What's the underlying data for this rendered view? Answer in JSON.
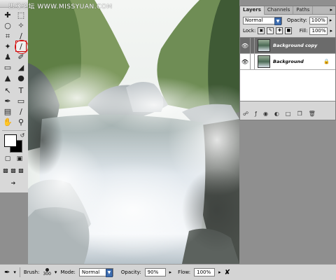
{
  "watermark": "思缘论坛 WWW.MISSYUAN.COM",
  "toolbox": {
    "tools": [
      {
        "name": "move-tool-icon",
        "glyph": "✚"
      },
      {
        "name": "marquee-tool-icon",
        "glyph": "⬚"
      },
      {
        "name": "lasso-tool-icon",
        "glyph": "○"
      },
      {
        "name": "magic-wand-tool-icon",
        "glyph": "✧"
      },
      {
        "name": "crop-tool-icon",
        "glyph": "⌗"
      },
      {
        "name": "slice-tool-icon",
        "glyph": "∕"
      },
      {
        "name": "healing-brush-tool-icon",
        "glyph": "✦"
      },
      {
        "name": "brush-tool-icon",
        "glyph": "∕"
      },
      {
        "name": "clone-stamp-tool-icon",
        "glyph": "♟"
      },
      {
        "name": "history-brush-tool-icon",
        "glyph": "✐"
      },
      {
        "name": "eraser-tool-icon",
        "glyph": "▭"
      },
      {
        "name": "paint-bucket-tool-icon",
        "glyph": "◢"
      },
      {
        "name": "blur-tool-icon",
        "glyph": "▲"
      },
      {
        "name": "dodge-tool-icon",
        "glyph": "●"
      },
      {
        "name": "path-selection-tool-icon",
        "glyph": "↖"
      },
      {
        "name": "type-tool-icon",
        "glyph": "T"
      },
      {
        "name": "pen-tool-icon",
        "glyph": "✒"
      },
      {
        "name": "shape-tool-icon",
        "glyph": "▭"
      },
      {
        "name": "notes-tool-icon",
        "glyph": "▤"
      },
      {
        "name": "eyedropper-tool-icon",
        "glyph": "∕"
      },
      {
        "name": "hand-tool-icon",
        "glyph": "✋"
      },
      {
        "name": "zoom-tool-icon",
        "glyph": "⚲"
      }
    ]
  },
  "layers_panel": {
    "tabs": [
      "Layers",
      "Channels",
      "Paths"
    ],
    "blend_mode": "Normal",
    "opacity_label": "Opacity:",
    "opacity_value": "100%",
    "lock_label": "Lock:",
    "fill_label": "Fill:",
    "fill_value": "100%",
    "layers": [
      {
        "name": "Background copy",
        "selected": true,
        "locked": false
      },
      {
        "name": "Background",
        "selected": false,
        "locked": true
      }
    ]
  },
  "options_bar": {
    "brush_label": "Brush:",
    "brush_size": "300",
    "mode_label": "Mode:",
    "mode_value": "Normal",
    "opacity_label": "Opacity:",
    "opacity_value": "90%",
    "flow_label": "Flow:",
    "flow_value": "100%"
  }
}
